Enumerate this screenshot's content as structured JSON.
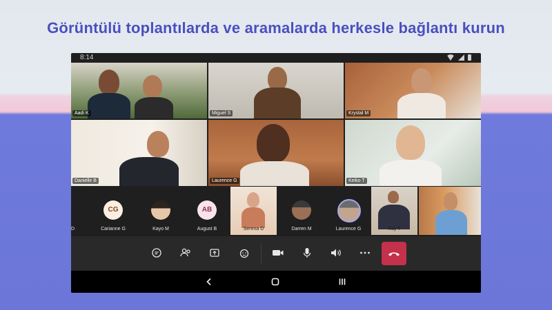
{
  "headline": "Görüntülü toplantılarda ve aramalarda herkesle bağlantı kurun",
  "device": {
    "status_time": "8:14",
    "status_icons": [
      "wifi-icon",
      "signal-icon",
      "battery-icon"
    ]
  },
  "video_tiles": [
    {
      "name": "Aadi K"
    },
    {
      "name": "Miguel S"
    },
    {
      "name": "Krystal M"
    },
    {
      "name": "Danielle B"
    },
    {
      "name": "Laurence G"
    },
    {
      "name": "Keiko T"
    }
  ],
  "participants": [
    {
      "name": "D",
      "kind": "partial"
    },
    {
      "name": "Carianne G",
      "initials": "CG",
      "kind": "initials",
      "bg": "#fdeee2",
      "fg": "#7a4a26"
    },
    {
      "name": "Kayo M",
      "kind": "avatar"
    },
    {
      "name": "August B",
      "initials": "AB",
      "kind": "initials",
      "bg": "#fbe3ea",
      "fg": "#8a3550"
    },
    {
      "name": "Serena D",
      "kind": "video"
    },
    {
      "name": "Darren M",
      "kind": "avatar"
    },
    {
      "name": "Laurence G",
      "kind": "avatar-highlight"
    },
    {
      "name": "Ray T",
      "kind": "video"
    },
    {
      "name": "",
      "kind": "video"
    }
  ],
  "call_controls": [
    {
      "icon": "chat-icon"
    },
    {
      "icon": "people-icon"
    },
    {
      "icon": "share-screen-icon"
    },
    {
      "icon": "reactions-icon"
    },
    {
      "icon": "camera-icon"
    },
    {
      "icon": "microphone-icon"
    },
    {
      "icon": "speaker-icon"
    },
    {
      "icon": "more-options-icon"
    },
    {
      "icon": "hang-up-icon"
    }
  ],
  "colors": {
    "headline": "#4b4fbe",
    "hangup": "#c4314b",
    "call_bar": "#292929",
    "device_bg": "#1f1f1f"
  },
  "nav_buttons": [
    "back-icon",
    "home-icon",
    "recents-icon"
  ]
}
